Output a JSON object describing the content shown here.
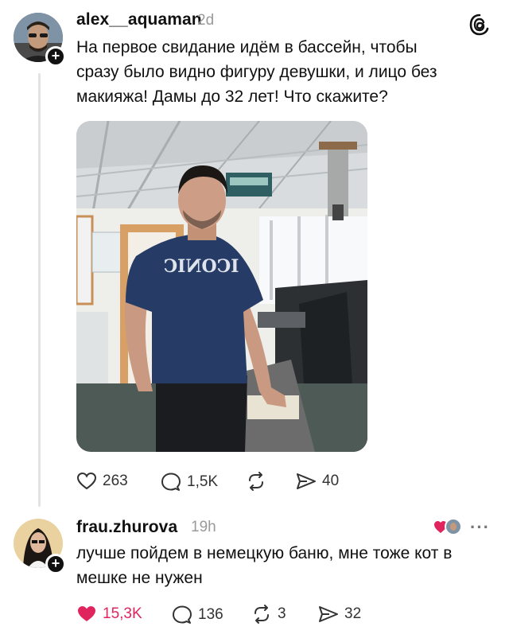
{
  "post": {
    "username": "alex__aquaman",
    "time": "2d",
    "text_line1": "На первое свидание идём в бассейн, чтобы",
    "text_line2": "сразу было видно фигуру девушки, и лицо без",
    "text_line3": "макияжа! Дамы до 32 лет! Что скажите?",
    "shirt_text": "ICONIC",
    "likes": "263",
    "comments": "1,5K",
    "shares": "40",
    "icons": [
      "heart-icon",
      "comment-icon",
      "repost-icon",
      "send-icon",
      "threads-logo-icon"
    ]
  },
  "reply": {
    "username": "frau.zhurova",
    "time": "19h",
    "text_line1": "лучше пойдем в немецкую баню, мне тоже кот в",
    "text_line2": "мешке не нужен",
    "likes": "15,3K",
    "comments": "136",
    "reposts": "3",
    "shares": "32",
    "more": "···",
    "like_color": "#e0245e"
  }
}
